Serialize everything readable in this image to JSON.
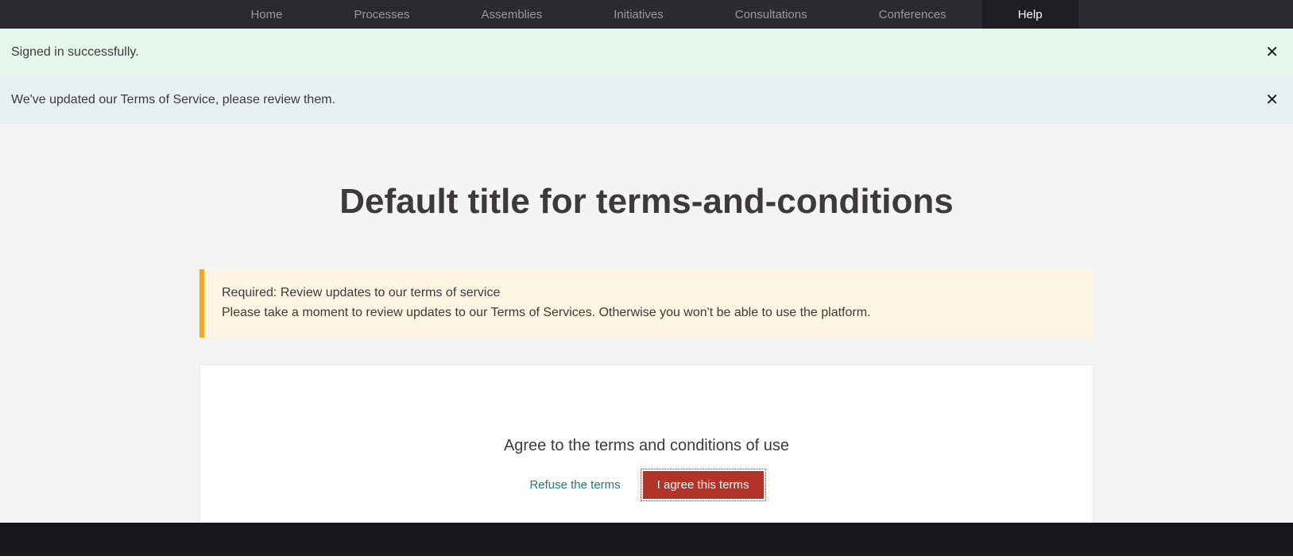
{
  "nav": {
    "items": [
      {
        "label": "Home",
        "active": false
      },
      {
        "label": "Processes",
        "active": false
      },
      {
        "label": "Assemblies",
        "active": false
      },
      {
        "label": "Initiatives",
        "active": false
      },
      {
        "label": "Consultations",
        "active": false
      },
      {
        "label": "Conferences",
        "active": false
      },
      {
        "label": "Help",
        "active": true
      }
    ]
  },
  "flash": {
    "success": "Signed in successfully.",
    "info": "We've updated our Terms of Service, please review them."
  },
  "page": {
    "title": "Default title for terms-and-conditions"
  },
  "callout": {
    "heading": "Required: Review updates to our terms of service",
    "body": "Please take a moment to review updates to our Terms of Services. Otherwise you won't be able to use the platform."
  },
  "card": {
    "heading": "Agree to the terms and conditions of use",
    "refuse_label": "Refuse the terms",
    "agree_label": "I agree this terms"
  }
}
